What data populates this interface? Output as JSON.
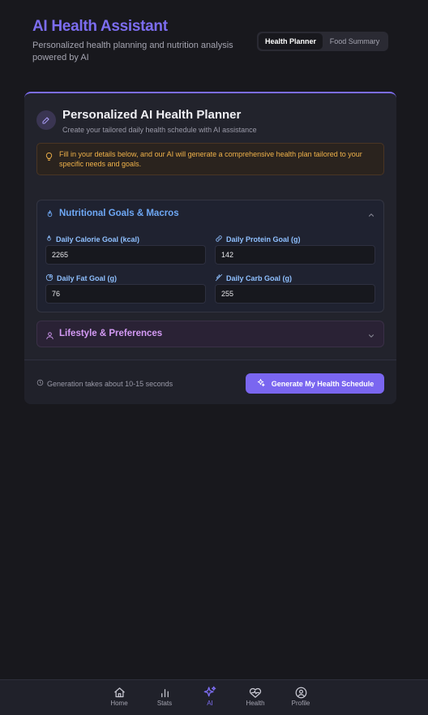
{
  "header": {
    "title": "AI Health Assistant",
    "subtitle": "Personalized health planning and nutrition analysis powered by AI"
  },
  "tabs": [
    {
      "label": "Health Planner",
      "active": true
    },
    {
      "label": "Food Summary",
      "active": false
    }
  ],
  "planner": {
    "title": "Personalized AI Health Planner",
    "description": "Create your tailored daily health schedule with AI assistance",
    "notice": "Fill in your details below, and our AI will generate a comprehensive health plan tailored to your specific needs and goals."
  },
  "nutrition": {
    "title": "Nutritional Goals & Macros",
    "expanded": true,
    "fields": {
      "calorie": {
        "label": "Daily Calorie Goal (kcal)",
        "value": "2265",
        "icon": "flame-icon"
      },
      "protein": {
        "label": "Daily Protein Goal (g)",
        "value": "142",
        "icon": "link-icon"
      },
      "fat": {
        "label": "Daily Fat Goal (g)",
        "value": "76",
        "icon": "pie-icon"
      },
      "carb": {
        "label": "Daily Carb Goal (g)",
        "value": "255",
        "icon": "wheat-icon"
      }
    }
  },
  "lifestyle": {
    "title": "Lifestyle & Preferences",
    "expanded": false
  },
  "footer": {
    "time_note": "Generation takes about 10-15 seconds",
    "generate_label": "Generate My Health Schedule"
  },
  "nav": [
    {
      "label": "Home",
      "icon": "home-icon",
      "active": false
    },
    {
      "label": "Stats",
      "icon": "bar-chart-icon",
      "active": false
    },
    {
      "label": "AI",
      "icon": "sparkles-icon",
      "active": true
    },
    {
      "label": "Health",
      "icon": "heart-pulse-icon",
      "active": false
    },
    {
      "label": "Profile",
      "icon": "user-circle-icon",
      "active": false
    }
  ],
  "colors": {
    "accent": "#7c6df0",
    "nutrition_title": "#6ea8f5",
    "lifestyle_title": "#d49af5",
    "notice_text": "#f0b24a"
  }
}
